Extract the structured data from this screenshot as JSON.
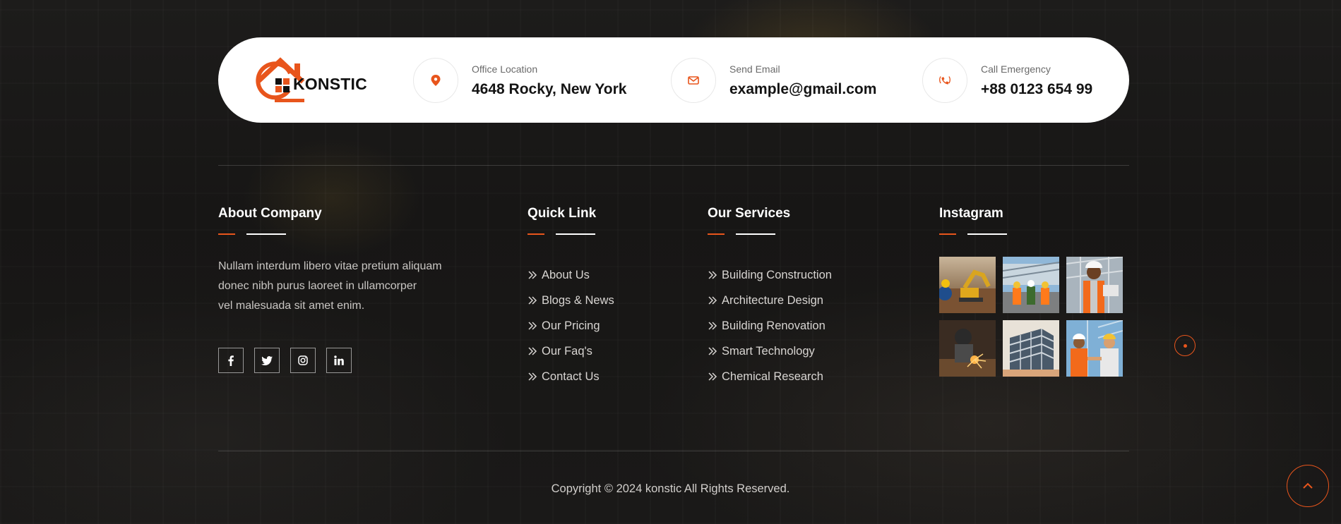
{
  "brand": {
    "name": "KONSTIC",
    "accent_color": "#e8551c"
  },
  "contacts": [
    {
      "icon": "map-pin-icon",
      "label": "Office Location",
      "value": "4648 Rocky, New York"
    },
    {
      "icon": "envelope-icon",
      "label": "Send Email",
      "value": "example@gmail.com"
    },
    {
      "icon": "phone-ringing-icon",
      "label": "Call Emergency",
      "value": "+88 0123 654 99"
    }
  ],
  "about": {
    "title": "About Company",
    "lines": [
      "Nullam interdum libero vitae pretium aliquam",
      "donec nibh purus laoreet in ullamcorper",
      "vel malesuada sit amet enim."
    ],
    "socials": [
      "facebook-icon",
      "twitter-icon",
      "instagram-icon",
      "linkedin-icon"
    ]
  },
  "quick_links": {
    "title": "Quick Link",
    "items": [
      "About Us",
      "Blogs & News",
      "Our Pricing",
      "Our Faq's",
      "Contact Us"
    ]
  },
  "services": {
    "title": "Our Services",
    "items": [
      "Building Construction",
      "Architecture Design",
      "Building Renovation",
      "Smart Technology",
      "Chemical Research"
    ]
  },
  "instagram": {
    "title": "Instagram",
    "images": [
      "excavator-photo",
      "workers-on-site-photo",
      "engineer-with-plans-photo",
      "welding-photo",
      "building-frame-photo",
      "engineers-handshake-photo"
    ]
  },
  "copyright": "Copyright © 2024 konstic All Rights Reserved."
}
